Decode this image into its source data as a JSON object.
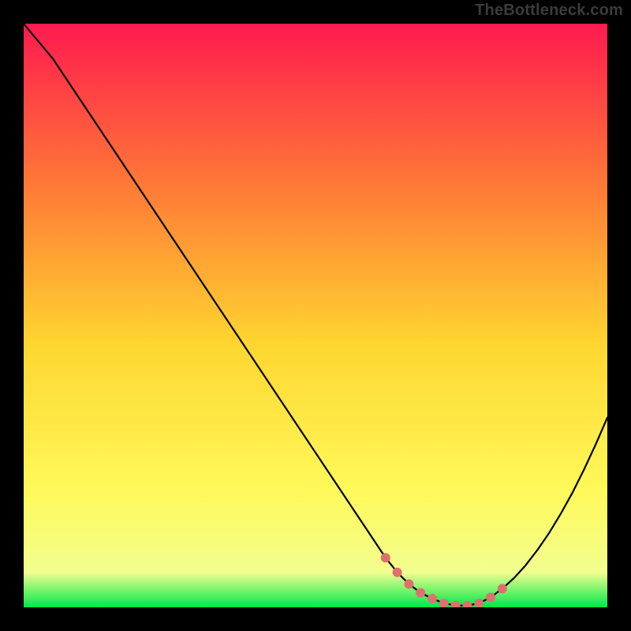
{
  "watermark": "TheBottleneck.com",
  "gradient": {
    "top": "#ff1a4f",
    "upper_mid": "#ff7a36",
    "mid": "#ffd630",
    "lower_mid": "#fff95a",
    "near_bottom": "#f2ff8f",
    "bottom": "#00e84a"
  },
  "chart_data": {
    "type": "line",
    "title": "",
    "xlabel": "",
    "ylabel": "",
    "xlim": [
      0,
      100
    ],
    "ylim": [
      0,
      100
    ],
    "x": [
      0,
      5,
      10,
      15,
      20,
      25,
      30,
      35,
      40,
      45,
      50,
      55,
      60,
      62,
      64,
      66,
      68,
      70,
      72,
      74,
      76,
      78,
      80,
      82,
      84,
      86,
      88,
      90,
      92,
      94,
      96,
      98,
      100
    ],
    "values": [
      100,
      94,
      86.5,
      79,
      71.5,
      64,
      56.5,
      49,
      41.5,
      34,
      26.5,
      19,
      11.5,
      8.5,
      6,
      4,
      2.5,
      1.5,
      0.7,
      0.3,
      0.3,
      0.7,
      1.7,
      3.2,
      5.0,
      7.2,
      9.8,
      12.7,
      16.0,
      19.6,
      23.6,
      27.9,
      32.5
    ],
    "markers": {
      "x": [
        62,
        64,
        66,
        68,
        70,
        72,
        74,
        76,
        78,
        80,
        82
      ],
      "y": [
        8.5,
        6,
        4,
        2.5,
        1.5,
        0.7,
        0.3,
        0.3,
        0.7,
        1.7,
        3.2
      ],
      "color": "#e07070",
      "radius_px": 6
    }
  }
}
